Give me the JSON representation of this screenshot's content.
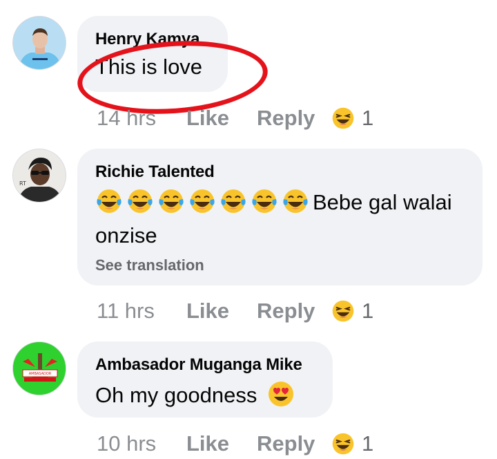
{
  "comments": [
    {
      "author": "Henry Kamya",
      "text": "This is love",
      "time": "14 hrs",
      "like": "Like",
      "reply": "Reply",
      "reaction_count": "1",
      "reaction": "laughing-emoji"
    },
    {
      "author": "Richie Talented",
      "text": "Bebe gal walai onzise",
      "text_line1": "Bebe gal walai",
      "text_line2": "onzise",
      "leading_emoji": "tears-of-joy x7",
      "see_translation": "See translation",
      "time": "11 hrs",
      "like": "Like",
      "reply": "Reply",
      "reaction_count": "1",
      "reaction": "laughing-emoji"
    },
    {
      "author": "Ambasador Muganga Mike",
      "text": "Oh my goodness",
      "trailing_emoji": "heart-eyes",
      "time": "10 hrs",
      "like": "Like",
      "reply": "Reply",
      "reaction_count": "1",
      "reaction": "laughing-emoji"
    }
  ],
  "colors": {
    "bubble": "#f0f2f5",
    "annotation": "#e4121b",
    "meta": "#65676b"
  }
}
